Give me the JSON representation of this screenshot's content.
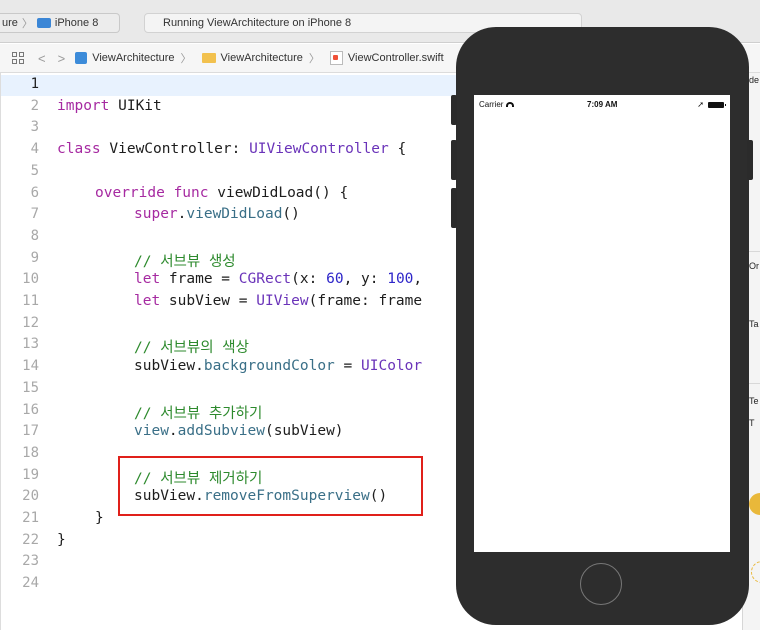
{
  "toolbar": {
    "scheme_target": "ure",
    "device": "iPhone 8",
    "activity_status": "Running ViewArchitecture on iPhone 8"
  },
  "jumpbar": {
    "crumbs": [
      "ViewArchitecture",
      "ViewArchitecture",
      "ViewController.swift"
    ],
    "icons": [
      "grid-icon",
      "back-arrow-icon",
      "forward-arrow-icon",
      "project-icon",
      "folder-icon",
      "swift-file-icon"
    ]
  },
  "editor": {
    "current_line": 1,
    "line_numbers": [
      "1",
      "2",
      "3",
      "4",
      "5",
      "6",
      "7",
      "8",
      "9",
      "10",
      "11",
      "12",
      "13",
      "14",
      "15",
      "16",
      "17",
      "18",
      "19",
      "20",
      "21",
      "22",
      "23",
      "24"
    ],
    "lines": {
      "l2": {
        "kw": "import",
        "rest": " UIKit"
      },
      "l4": {
        "kw": "class",
        "mid": " ViewController: ",
        "ty": "UIViewController",
        "rest": " {"
      },
      "l6": {
        "kw1": "override",
        "sp": " ",
        "kw2": "func",
        "rest": " viewDidLoad() {"
      },
      "l7": {
        "kw": "super",
        "dot": ".",
        "fn": "viewDidLoad",
        "rest": "()"
      },
      "l9": {
        "cm": "// 서브뷰 생성"
      },
      "l10": {
        "kw": "let",
        "a": " frame = ",
        "ty": "CGRect",
        "b": "(x: ",
        "n1": "60",
        "c": ", y: ",
        "n2": "100",
        "d": ","
      },
      "l11": {
        "kw": "let",
        "a": " subView = ",
        "ty": "UIView",
        "b": "(frame: frame"
      },
      "l13": {
        "cm": "// 서브뷰의 색상"
      },
      "l14": {
        "a": "subView.",
        "fn": "backgroundColor",
        "b": " = ",
        "ty": "UIColor"
      },
      "l16": {
        "cm": "// 서브뷰 추가하기"
      },
      "l17": {
        "kw": "view",
        "dot": ".",
        "fn": "addSubview",
        "rest": "(subView)"
      },
      "l19": {
        "cm": "// 서브뷰 제거하기"
      },
      "l20": {
        "a": "subView.",
        "fn": "removeFromSuperview",
        "rest": "()"
      },
      "l21": {
        "rest": "}"
      },
      "l22": {
        "rest": "}"
      }
    }
  },
  "simulator": {
    "carrier": "Carrier",
    "time": "7:09 AM"
  },
  "inspector": {
    "fragments": [
      "de",
      "Or",
      "Ta",
      "Te",
      "T"
    ]
  },
  "colors": {
    "keyword": "#a62aa1",
    "type": "#6a33b9",
    "function": "#3a6f87",
    "number": "#2e26c9",
    "comment": "#2d8a2d",
    "highlight_box": "#e0201a"
  }
}
